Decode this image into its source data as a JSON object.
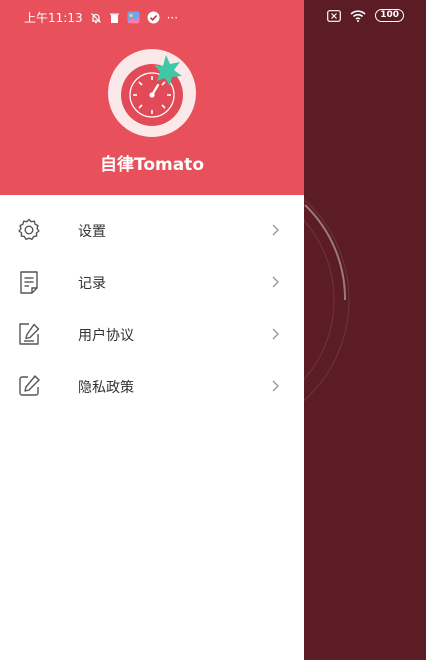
{
  "status_bar": {
    "time": "上午11:13",
    "battery": "100",
    "icons": [
      "bell-off-icon",
      "trash-icon",
      "gallery-icon",
      "check-circle-icon",
      "more-dots-icon",
      "sim-x-icon",
      "wifi-icon",
      "battery-icon"
    ],
    "more": "···"
  },
  "drawer": {
    "app_title": "自律Tomato",
    "header_color": "#e8505b",
    "menu": [
      {
        "label": "设置",
        "icon": "gear-icon"
      },
      {
        "label": "记录",
        "icon": "document-icon"
      },
      {
        "label": "用户协议",
        "icon": "edit-note-icon"
      },
      {
        "label": "隐私政策",
        "icon": "pencil-square-icon"
      }
    ]
  },
  "colors": {
    "backdrop": "#5b1c26",
    "accent": "#e8505b",
    "leaf": "#3fc7a6"
  }
}
